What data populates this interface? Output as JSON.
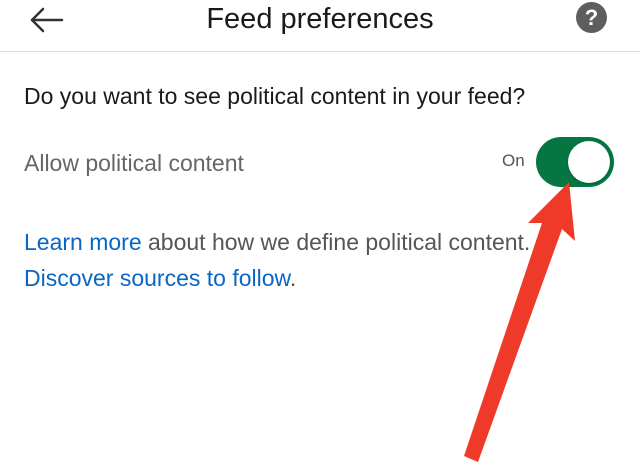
{
  "header": {
    "title": "Feed preferences",
    "back_icon": "arrow-left-icon",
    "help_label": "?"
  },
  "main": {
    "question": "Do you want to see political content in your feed?",
    "setting": {
      "label": "Allow political content",
      "state_label": "On",
      "enabled": true,
      "toggle_color": "#057642"
    },
    "info": {
      "learn_more_link": "Learn more",
      "learn_more_rest": " about how we define political content.",
      "discover_link": "Discover sources to follow",
      "discover_suffix": "."
    }
  },
  "colors": {
    "link": "#0a66c2",
    "annotation_arrow": "#ef3a2a"
  }
}
